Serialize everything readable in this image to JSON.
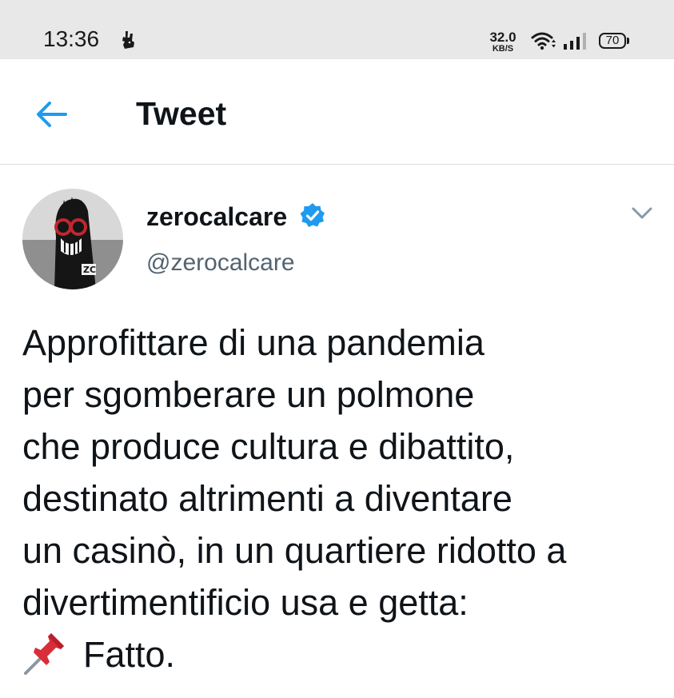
{
  "status_bar": {
    "time": "13:36",
    "notification_icon": "deliveroo-kangaroo-icon",
    "net_speed_value": "32.0",
    "net_speed_unit": "KB/S",
    "wifi_icon": "wifi-icon",
    "signal_icon": "cell-signal-icon",
    "battery_level": "70"
  },
  "header": {
    "back_icon": "arrow-left-icon",
    "title": "Tweet"
  },
  "tweet": {
    "author": {
      "display_name": "zerocalcare",
      "verified": true,
      "handle": "@zerocalcare",
      "avatar_badge": "ZC"
    },
    "more_icon": "chevron-down-icon",
    "text_lines": [
      "Approfittare di una pandemia",
      "per sgomberare un polmone",
      "che produce cultura e dibattito,",
      "destinato altrimenti a diventare",
      "un casinò, in un quartiere ridotto a",
      "divertimentificio usa e getta:"
    ],
    "last_line_icon": "pushpin-icon",
    "last_line_text": "Fatto."
  },
  "colors": {
    "accent_blue": "#1d9bf0",
    "text_primary": "#0f1419",
    "text_secondary": "#536471",
    "status_bar_bg": "#e8e8e8",
    "divider": "#d9dee2",
    "pin_red": "#d72e3a"
  }
}
